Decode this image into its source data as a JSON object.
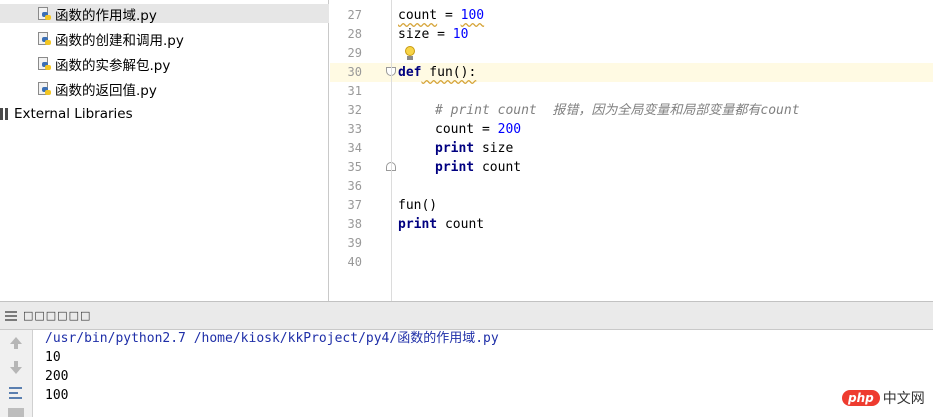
{
  "project_tree": {
    "files": [
      {
        "name": "函数的作用域.py",
        "selected": true
      },
      {
        "name": "函数的创建和调用.py",
        "selected": false
      },
      {
        "name": "函数的实参解包.py",
        "selected": false
      },
      {
        "name": "函数的返回值.py",
        "selected": false
      }
    ],
    "external_libraries": "External Libraries"
  },
  "editor": {
    "line_numbers": [
      "27",
      "28",
      "29",
      "30",
      "31",
      "32",
      "33",
      "34",
      "35",
      "36",
      "37",
      "38",
      "39",
      "40"
    ],
    "lines": {
      "l27_var": "count",
      "l27_op": " = ",
      "l27_num": "100",
      "l28_var": "size",
      "l28_op": " = ",
      "l28_num": "10",
      "l30_kw": "def",
      "l30_rest": " fun():",
      "l32_comment": "# print count  报错，因为全局变量和局部变量都有count",
      "l33_var": "count",
      "l33_op": " = ",
      "l33_num": "200",
      "l34_kw": "print",
      "l34_rest": " size",
      "l35_kw": "print",
      "l35_rest": " count",
      "l37_call": "fun()",
      "l38_kw": "print",
      "l38_rest": " count"
    }
  },
  "run_panel": {
    "title": "□□□□□□",
    "output": [
      "/usr/bin/python2.7 /home/kiosk/kkProject/py4/函数的作用域.py",
      "10",
      "200",
      "100"
    ]
  },
  "watermark": {
    "logo": "php",
    "text": "中文网"
  },
  "colors": {
    "keyword": "#000080",
    "number": "#0000ff",
    "comment": "#808080",
    "caret_line": "#fffae3",
    "path": "#1f2fa8"
  }
}
